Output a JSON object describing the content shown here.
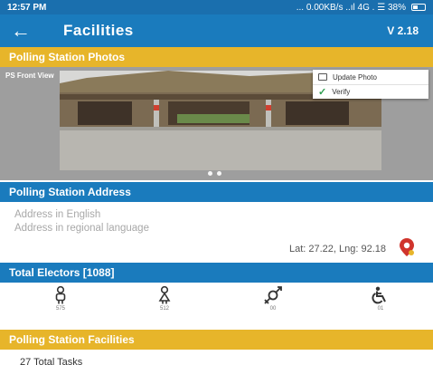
{
  "status_bar": {
    "time": "12:57 PM",
    "network": "... 0.00KB/s ..ıl 4G . ☰ 38%",
    "battery_icon": "battery-icon"
  },
  "app_bar": {
    "title": "Facilities",
    "version": "V 2.18",
    "back_icon": "arrow-left"
  },
  "photos": {
    "header": "Polling Station Photos",
    "label": "PS Front View",
    "menu": {
      "upload": "Update Photo",
      "verify": "Verify"
    },
    "pager_dots": 2
  },
  "address": {
    "header": "Polling Station Address",
    "english_placeholder": "Address in English",
    "regional_placeholder": "Address in regional language",
    "latlng": "Lat: 27.22, Lng: 92.18",
    "pin_icon": "map-pin"
  },
  "electors": {
    "header": "Total Electors [1088]",
    "items": [
      {
        "icon": "male-icon",
        "count": "575"
      },
      {
        "icon": "female-icon",
        "count": "512"
      },
      {
        "icon": "transgender-icon",
        "count": "00"
      },
      {
        "icon": "wheelchair-icon",
        "count": "01"
      }
    ]
  },
  "facilities": {
    "header": "Polling Station Facilities",
    "tasks": "27 Total Tasks"
  },
  "colors": {
    "primary_blue": "#1a7bbd",
    "gold": "#e7b52a"
  }
}
